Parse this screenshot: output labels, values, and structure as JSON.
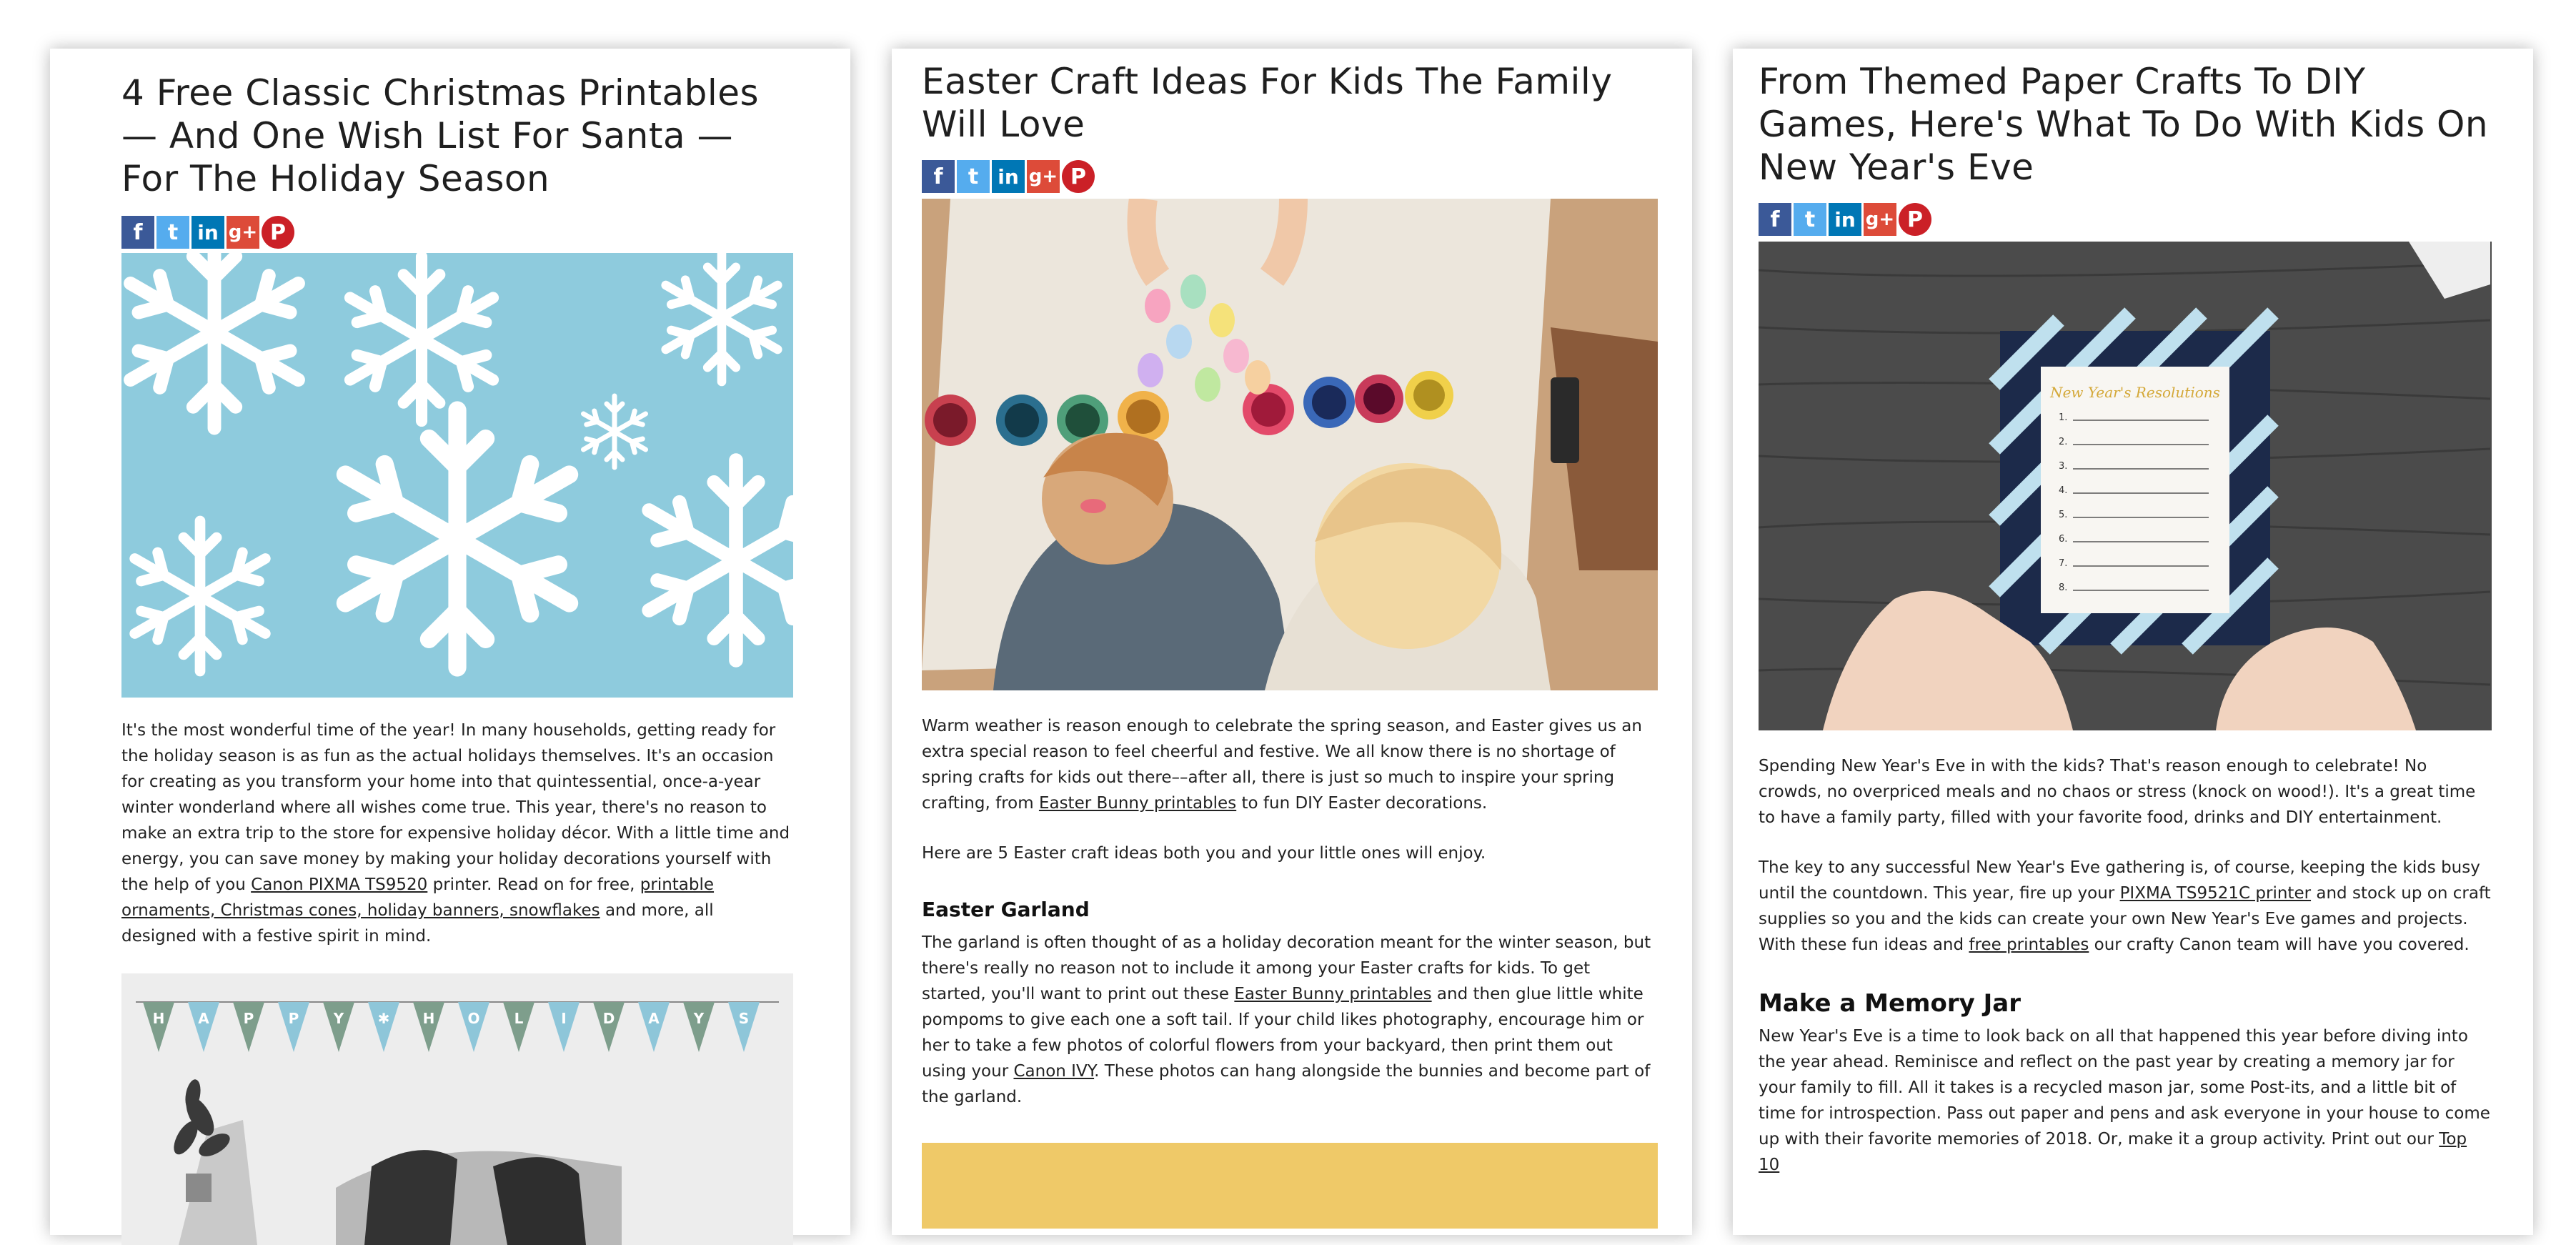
{
  "cards": [
    {
      "title": "4 Free Classic Christmas Printables — And One Wish List For Santa — For The Holiday Season",
      "social": [
        "f",
        "t",
        "in",
        "g+",
        "P"
      ],
      "hero_alt": "snowflake pattern",
      "intro_p1": "It's the most wonderful time of the year! In many households, getting ready for the holiday season is as fun as the actual holidays themselves. It's an occasion for creating as you transform your home into that quintessential, once-a-year winter wonderland where all wishes come true. This year, there's no reason to make an extra trip to the store for expensive holiday décor. With a little time and energy, you can save money by making your holiday decorations yourself with the help of you ",
      "link_printer": "Canon PIXMA TS9520",
      "intro_p2": " printer. Read on for free, ",
      "link_items": "printable ornaments, Christmas cones, holiday banners, snowflakes",
      "intro_p3": " and more, all designed with a festive spirit in mind.",
      "banner_letters": [
        "H",
        "A",
        "P",
        "P",
        "Y",
        "✱",
        "H",
        "O",
        "L",
        "I",
        "D",
        "A",
        "Y",
        "S"
      ]
    },
    {
      "title": "Easter Craft Ideas For Kids The Family Will Love",
      "social": [
        "f",
        "t",
        "in",
        "g+",
        "P"
      ],
      "p1a": "Warm weather is reason enough to celebrate the spring season, and Easter gives us an extra special reason to feel cheerful and festive. We all know there is no shortage of spring crafts for kids out there––after all, there is just so much to inspire your spring crafting, from ",
      "p1_link": "Easter Bunny printables",
      "p1b": " to fun DIY Easter decorations.",
      "p2": "Here are 5 Easter craft ideas both you and your little ones will enjoy.",
      "h_garland": "Easter Garland",
      "p3a": "The garland is often thought of as a holiday decoration meant for the winter season, but there's really no reason not to include it among your Easter crafts for kids. To get started, you'll want to print out these ",
      "p3_link1": "Easter Bunny printables",
      "p3b": " and then glue little white pompoms to give each one a soft tail. If your child likes photography, encourage him or her to take a few photos of colorful flowers from your backyard, then print them out using your ",
      "p3_link2": "Canon IVY",
      "p3c": ". These photos can hang alongside the bunnies and become part of the garland."
    },
    {
      "title": "From Themed Paper Crafts To DIY Games, Here's What To Do With Kids On New Year's Eve",
      "social": [
        "f",
        "t",
        "in",
        "g+",
        "P"
      ],
      "card_heading": "New Year's Resolutions",
      "card_numbers": [
        "1.",
        "2.",
        "3.",
        "4.",
        "5.",
        "6.",
        "7.",
        "8."
      ],
      "p1": "Spending New Year's Eve in with the kids? That's reason enough to celebrate! No crowds, no overpriced meals and no chaos or stress (knock on wood!). It's a great time to have a family party, filled with your favorite food, drinks and DIY entertainment.",
      "p2a": "The key to any successful New Year's Eve gathering is, of course, keeping the kids busy until the countdown. This year, fire up your ",
      "p2_link1": "PIXMA TS9521C printer",
      "p2b": " and stock up on craft supplies so you and the kids can create your own New Year's Eve games and projects. With these fun ideas and ",
      "p2_link2": "free printables",
      "p2c": " our crafty Canon team will have you covered.",
      "h_memory": "Make a Memory Jar",
      "p3a": "New Year's Eve is a time to look back on all that happened this year before diving into the year ahead. Reminisce and reflect on the past year by creating a memory jar for your family to fill. All it takes is a recycled mason jar, some Post-its, and a little bit of time for introspection. Pass out paper and pens and ask everyone in your house to come up with their favorite memories of 2018. Or, make it a group activity. Print out our ",
      "p3_link": "Top 10"
    }
  ],
  "colors": {
    "facebook": "#3b5998",
    "twitter": "#55acee",
    "linkedin": "#0077b5",
    "googleplus": "#dd4b39",
    "pinterest": "#cb2027",
    "snow_bg": "#8ecbdd",
    "banner_green": "#7e9e8c",
    "banner_blue": "#8ec6d9",
    "easter_yellow": "#efc968",
    "wood_dark": "#4a4a4a",
    "card_navy": "#1c2a4a"
  }
}
